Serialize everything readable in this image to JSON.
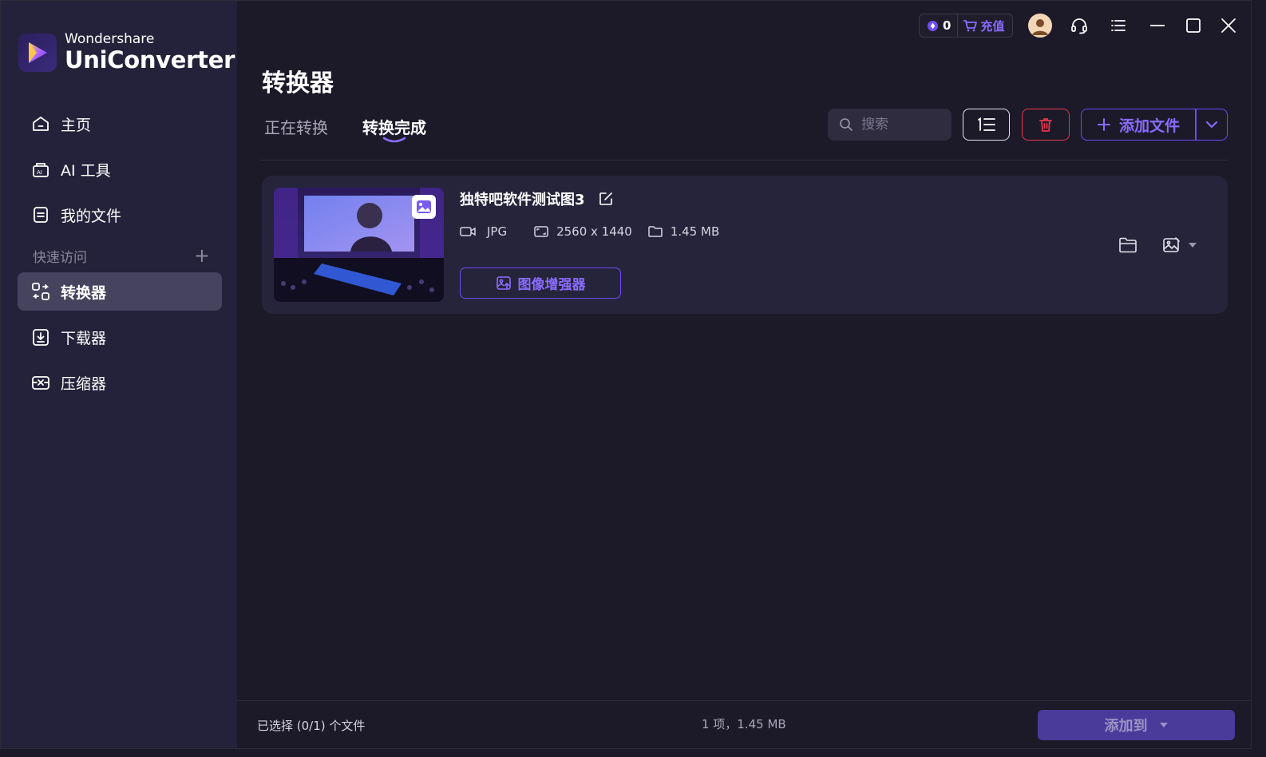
{
  "sidebar": {
    "brand": "Wondershare",
    "product": "UniConverter",
    "items": [
      {
        "label": "主页",
        "icon": "home-icon"
      },
      {
        "label": "AI 工具",
        "icon": "ai-tools-icon"
      },
      {
        "label": "我的文件",
        "icon": "my-files-icon"
      }
    ],
    "quick_access_label": "快速访问",
    "quick_access_add": "+",
    "tools": [
      {
        "label": "转换器",
        "icon": "converter-icon",
        "active": true
      },
      {
        "label": "下载器",
        "icon": "downloader-icon",
        "active": false
      },
      {
        "label": "压缩器",
        "icon": "compressor-icon",
        "active": false
      }
    ]
  },
  "topbar": {
    "credits": "0",
    "recharge": "充值"
  },
  "main": {
    "title": "转换器",
    "tabs": [
      {
        "label": "正在转换",
        "active": false
      },
      {
        "label": "转换完成",
        "active": true
      }
    ],
    "search_placeholder": "搜索",
    "add_file_label": "添加文件"
  },
  "file": {
    "name": "独特吧软件测试图3",
    "format": "JPG",
    "resolution": "2560 x 1440",
    "size": "1.45 MB",
    "enhance_label": "图像增强器"
  },
  "footer": {
    "selected": "已选择 (0/1) 个文件",
    "summary": "1 项，1.45 MB",
    "add_to_label": "添加到"
  },
  "colors": {
    "accent": "#6e4cf5",
    "accent_text": "#8a6cff",
    "danger": "#e8364a",
    "sidebar_bg": "#24223a",
    "main_bg": "#1c1a29",
    "card_bg": "#26243a"
  }
}
